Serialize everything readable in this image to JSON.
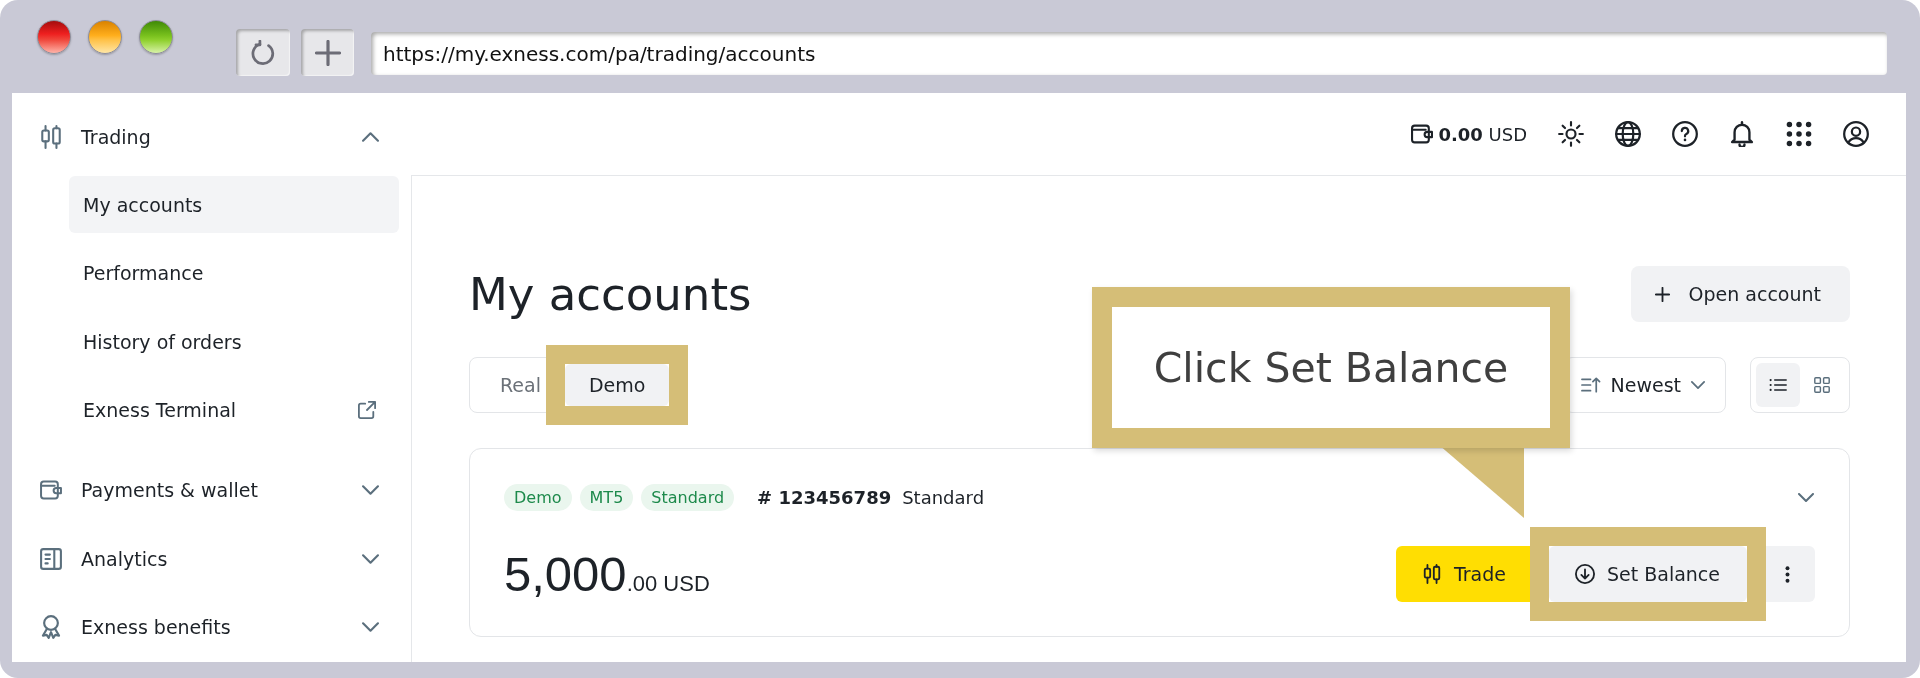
{
  "browser": {
    "url": "https://my.exness.com/pa/trading/accounts"
  },
  "sidebar": {
    "sections": [
      {
        "label": "Trading",
        "expanded": true,
        "children": [
          {
            "label": "My accounts",
            "selected": true,
            "external": false
          },
          {
            "label": "Performance",
            "selected": false,
            "external": false
          },
          {
            "label": "History of orders",
            "selected": false,
            "external": false
          },
          {
            "label": "Exness Terminal",
            "selected": false,
            "external": true
          }
        ]
      },
      {
        "label": "Payments & wallet",
        "expanded": false
      },
      {
        "label": "Analytics",
        "expanded": false
      },
      {
        "label": "Exness benefits",
        "expanded": false
      }
    ]
  },
  "header": {
    "balance": "**0.00** USD"
  },
  "page": {
    "title": "My accounts",
    "open_account_button": "Open account",
    "account_type_tabs": [
      {
        "label": "Real",
        "selected": false,
        "highlighted": false
      },
      {
        "label": "Demo",
        "selected": true,
        "highlighted": true
      }
    ],
    "sort": {
      "value": "Newest"
    },
    "view_modes": [
      {
        "selected": true
      },
      {
        "selected": false
      }
    ],
    "accounts": [
      {
        "tags": [
          "Demo",
          "MT5",
          "Standard"
        ],
        "number": "# 123456789",
        "type": "Standard",
        "balance_whole": "5,000",
        "balance_rest": ".00 USD",
        "expanded": false,
        "actions": [
          {
            "kind": "primary",
            "label": "Trade",
            "highlighted": false
          },
          {
            "kind": "secondary",
            "label": "Set Balance",
            "highlighted": true
          },
          {
            "kind": "more",
            "highlighted": false
          }
        ]
      }
    ]
  },
  "callout": {
    "text": "Click Set Balance"
  }
}
